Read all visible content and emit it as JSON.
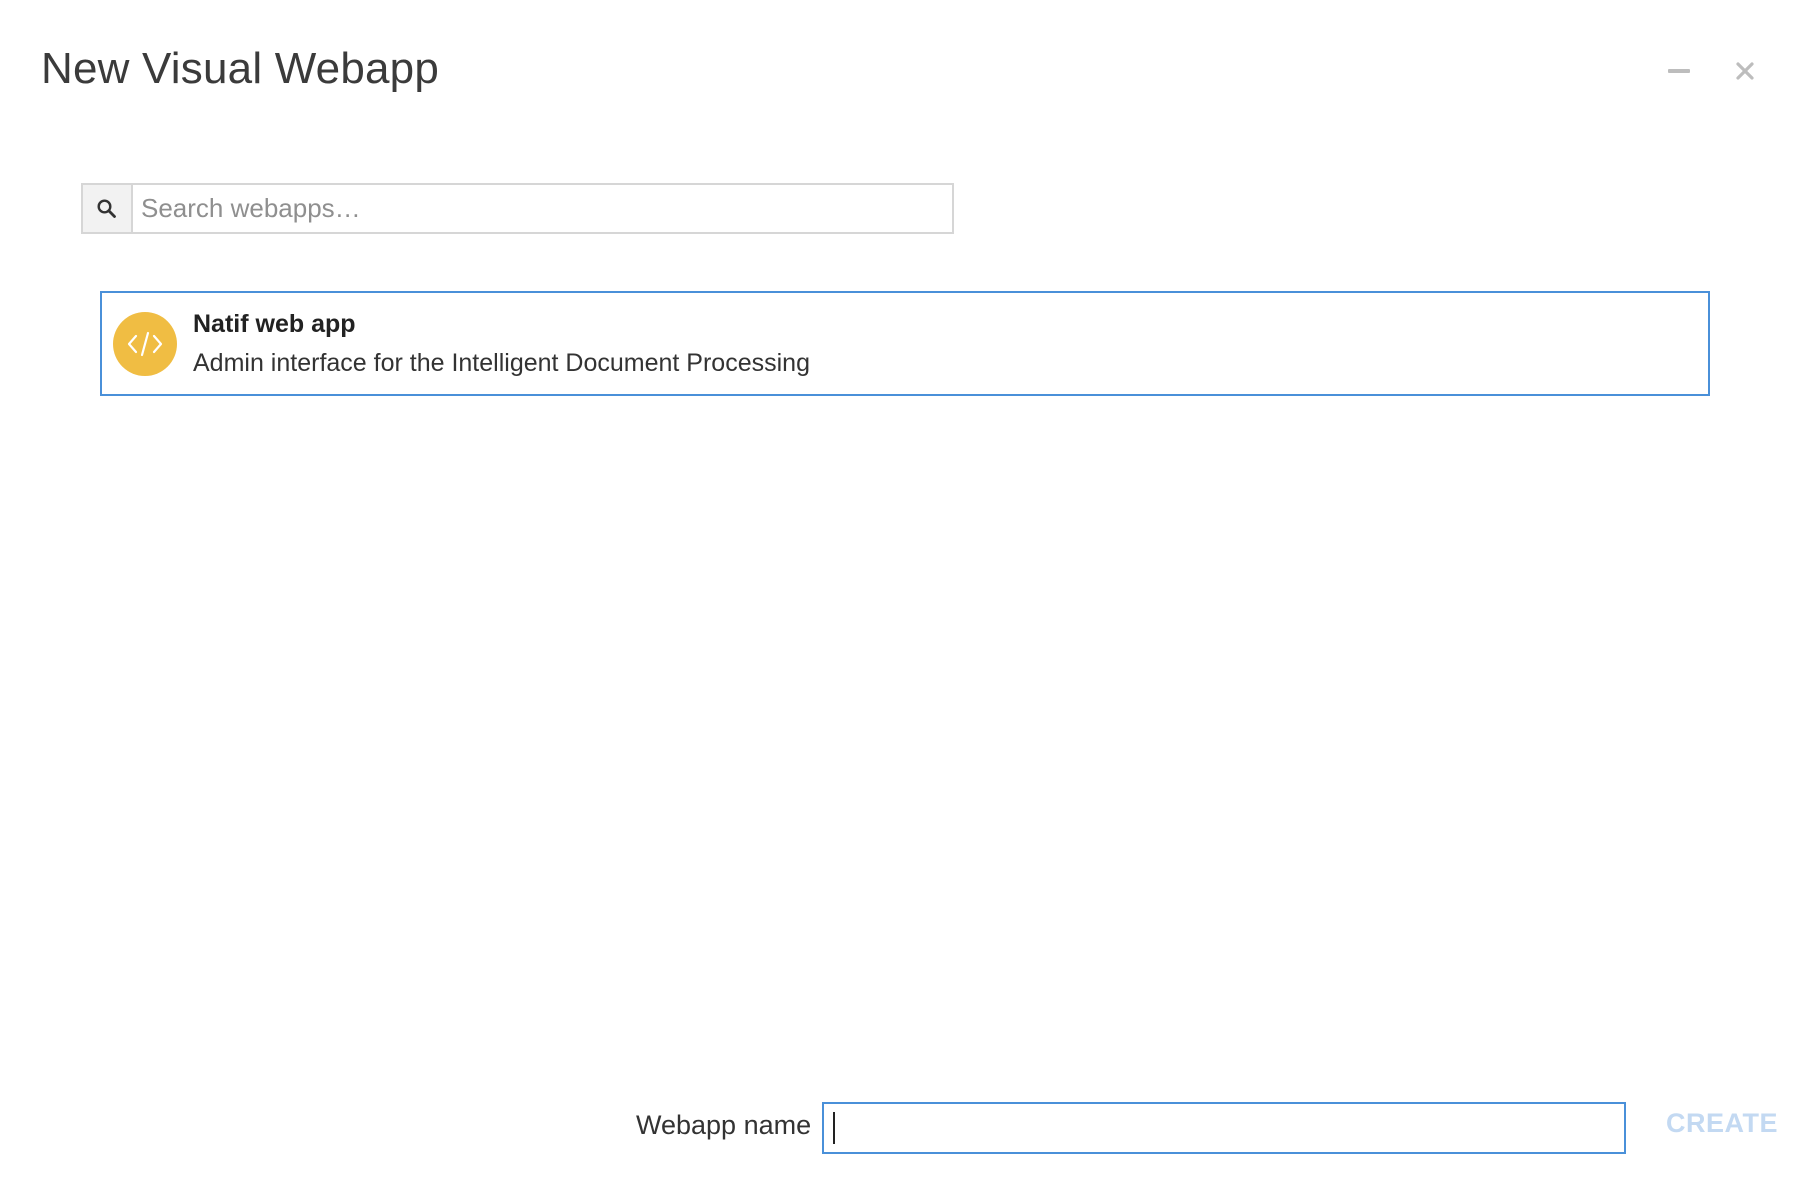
{
  "dialog": {
    "title": "New Visual Webapp",
    "minimize_icon": "minimize-icon",
    "close_icon": "close-icon"
  },
  "search": {
    "icon": "search-icon",
    "placeholder": "Search webapps…",
    "value": ""
  },
  "webapps": [
    {
      "title": "Natif web app",
      "description": "Admin interface for the Intelligent Document Processing",
      "icon": "code-icon",
      "icon_color": "#f0bd43",
      "selected": true
    }
  ],
  "footer": {
    "name_label": "Webapp name",
    "name_value": "",
    "create_label": "CREATE",
    "create_enabled": false
  },
  "colors": {
    "accent": "#4a90d9",
    "create_disabled": "#c3d9f2"
  }
}
